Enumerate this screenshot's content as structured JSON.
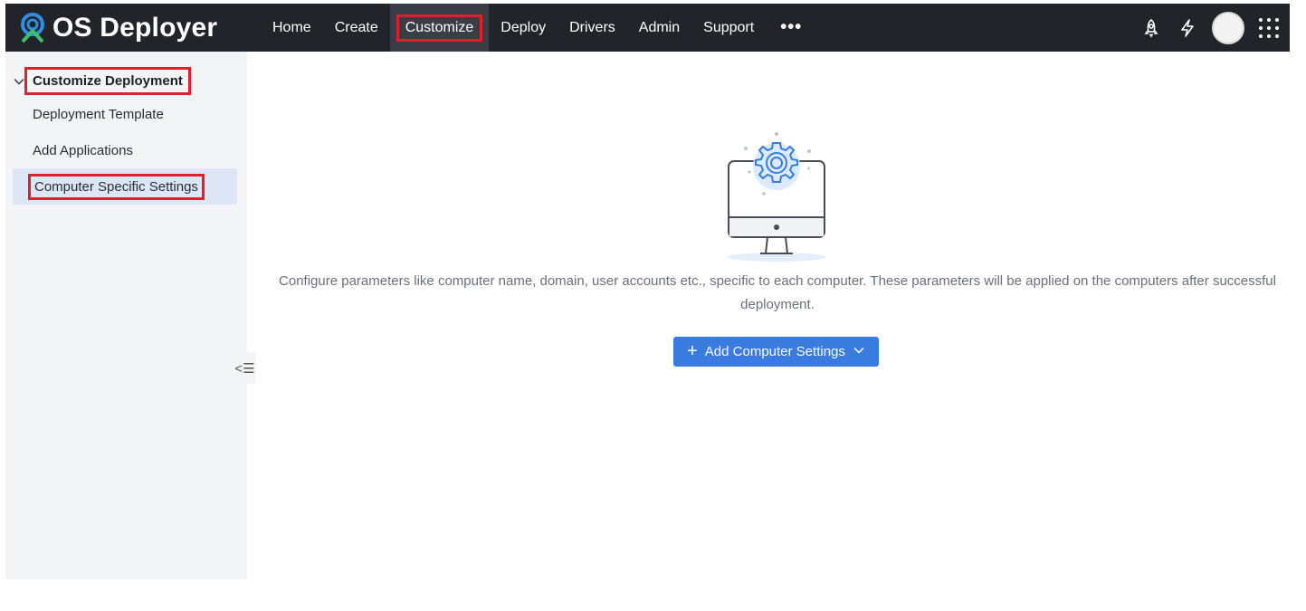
{
  "brand": {
    "name": "OS Deployer"
  },
  "nav": {
    "items": [
      {
        "label": "Home"
      },
      {
        "label": "Create"
      },
      {
        "label": "Customize"
      },
      {
        "label": "Deploy"
      },
      {
        "label": "Drivers"
      },
      {
        "label": "Admin"
      },
      {
        "label": "Support"
      }
    ],
    "active": "Customize",
    "more": "•••"
  },
  "topbar_icons": [
    "rocket-icon",
    "lightning-icon",
    "avatar",
    "app-grid-icon"
  ],
  "sidebar": {
    "section_title": "Customize Deployment",
    "items": [
      {
        "label": "Deployment Template"
      },
      {
        "label": "Add Applications"
      },
      {
        "label": "Computer Specific Settings"
      }
    ],
    "active": "Computer Specific Settings",
    "collapse_icon": "<☰"
  },
  "main": {
    "description": "Configure parameters like computer name, domain, user accounts etc., specific to each computer. These parameters will be applied on the computers after successful deployment.",
    "add_button_label": "Add Computer Settings"
  },
  "colors": {
    "topbar": "#22242a",
    "accent": "#3a7be0",
    "highlight": "#e0202a",
    "sidebar_bg": "#f3f4f6",
    "sidebar_active": "#dde6f7"
  }
}
